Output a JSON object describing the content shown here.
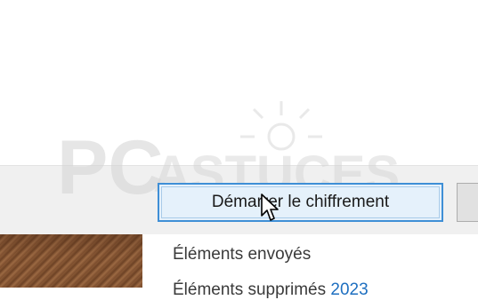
{
  "dialog": {
    "primary_button_label": "Démarrer le chiffrement"
  },
  "watermark": {
    "text_pc": "PC",
    "text_brand": "ASTUCES"
  },
  "menu": {
    "items": [
      {
        "label": "Éléments envoyés"
      },
      {
        "label": "Éléments supprimés",
        "accent": "2023"
      }
    ]
  },
  "colors": {
    "button_border": "#3f8fd6",
    "button_fill": "#e5f1fb",
    "bar_background": "#f0f0f0",
    "link_accent": "#1e6fc0"
  },
  "icons": {
    "cursor": "mouse-pointer-icon",
    "watermark_sun": "sun-logo-icon"
  }
}
